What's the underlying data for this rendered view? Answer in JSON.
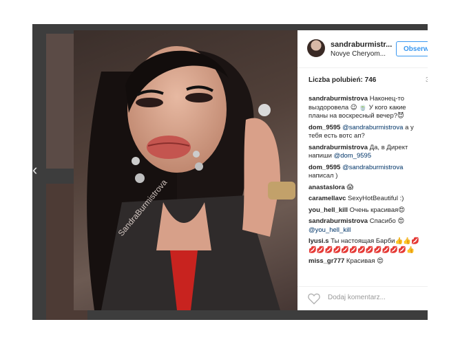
{
  "post": {
    "username": "sandraburmistr...",
    "location": "Novye Cheryom...",
    "follow_label": "Obserw",
    "likes": "Liczba polubień: 746",
    "age": "3",
    "watermark": "SandraBurmistrova",
    "add_comment_placeholder": "Dodaj komentarz..."
  },
  "comments": [
    {
      "user": "sandraburmistrova",
      "text": " Наконец-то выздоровела 😉 🍵 У кого какие планы на воскресный вечер?😈"
    },
    {
      "user": "dom_9595",
      "mention": "@sandraburmistrova",
      "text": " а у тебя есть вотс ап?"
    },
    {
      "user": "sandraburmistrova",
      "text": " Да, в Директ напиши ",
      "mention": "@dom_9595"
    },
    {
      "user": "dom_9595",
      "mention": "@sandraburmistrova",
      "text": " написал )"
    },
    {
      "user": "anastaslora",
      "text": " 😱"
    },
    {
      "user": "caramellavc",
      "text": " SexyHotBeautiful :)"
    },
    {
      "user": "you_hell_kill",
      "text": " Очень красивая😍"
    },
    {
      "user": "sandraburmistrova",
      "text": " Спасибо 😍 ",
      "mention": "@you_hell_kill"
    },
    {
      "user": "lyusi.s",
      "text": " Ты настоящая Барби👍👍💋💋💋💋💋💋💋💋💋💋💋💋💋👍"
    },
    {
      "user": "miss_gr777",
      "text": " Красивая 😍"
    }
  ],
  "icons": {
    "back": "chevron-left-icon",
    "like": "heart-icon"
  }
}
